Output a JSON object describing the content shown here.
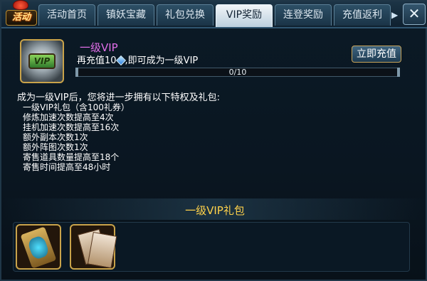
{
  "logo": {
    "text": "活动"
  },
  "tabs": [
    {
      "label": "活动首页",
      "active": false
    },
    {
      "label": "镇妖宝藏",
      "active": false
    },
    {
      "label": "礼包兑换",
      "active": false
    },
    {
      "label": "VIP奖励",
      "active": true
    },
    {
      "label": "连登奖励",
      "active": false
    },
    {
      "label": "充值返利",
      "active": false
    }
  ],
  "close_icon": "close-icon",
  "vip": {
    "title": "一级VIP",
    "desc_prefix": "再充值10",
    "desc_suffix": ",即可成为一级VIP",
    "gem_icon": "gem-icon",
    "progress_text": "0/10",
    "progress_fraction": 0,
    "recharge_label": "立即充值"
  },
  "privileges": {
    "intro": "成为一级VIP后，您将进一步拥有以下特权及礼包:",
    "items": [
      "一级VIP礼包（含100礼券）",
      "修炼加速次数提高至4次",
      "挂机加速次数提高至16次",
      "额外副本次数1次",
      "额外阵图次数1次",
      "寄售道具数量提高至18个",
      "寄售时间提高至48小时"
    ]
  },
  "package": {
    "title": "一级VIP礼包",
    "items": [
      {
        "icon": "scroll-item-icon"
      },
      {
        "icon": "cards-item-icon"
      }
    ]
  },
  "colors": {
    "vip_title": "#e06ee8",
    "package_title": "#ffd24a",
    "gold_border": "#c9a34a"
  }
}
